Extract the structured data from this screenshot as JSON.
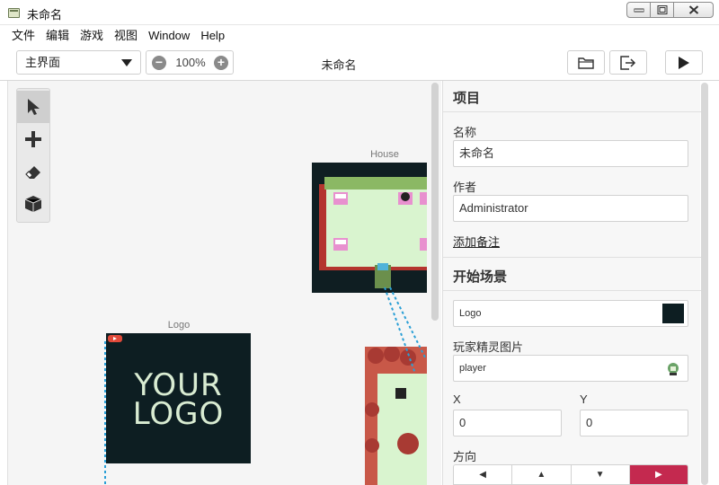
{
  "window": {
    "title": "未命名"
  },
  "menu": [
    "文件",
    "编辑",
    "游戏",
    "视图",
    "Window",
    "Help"
  ],
  "toolbar": {
    "view_selected": "主界面",
    "zoom": "100%",
    "project_title": "未命名"
  },
  "icons": {
    "tools": [
      "select-arrow-icon",
      "add-plus-icon",
      "eraser-icon",
      "block-cube-icon"
    ],
    "toolbar": [
      "open-folder-icon",
      "export-icon",
      "play-icon"
    ]
  },
  "canvas": {
    "scenes": [
      {
        "label": "House"
      },
      {
        "label": "Logo"
      }
    ],
    "logo_text_line1": "YOUR",
    "logo_text_line2": "LOGO",
    "connector_color": "#2a9fd6"
  },
  "panel": {
    "project_section": "项目",
    "name_label": "名称",
    "name_value": "未命名",
    "author_label": "作者",
    "author_value": "Administrator",
    "add_note": "添加备注",
    "start_section": "开始场景",
    "scene_value": "Logo",
    "sprite_label": "玩家精灵图片",
    "sprite_value": "player",
    "x_label": "X",
    "x_value": "0",
    "y_label": "Y",
    "y_value": "0",
    "dir_label": "方向",
    "dir_buttons": [
      "◀",
      "▲",
      "▼",
      "▶"
    ],
    "active_color": "#c4294f"
  }
}
